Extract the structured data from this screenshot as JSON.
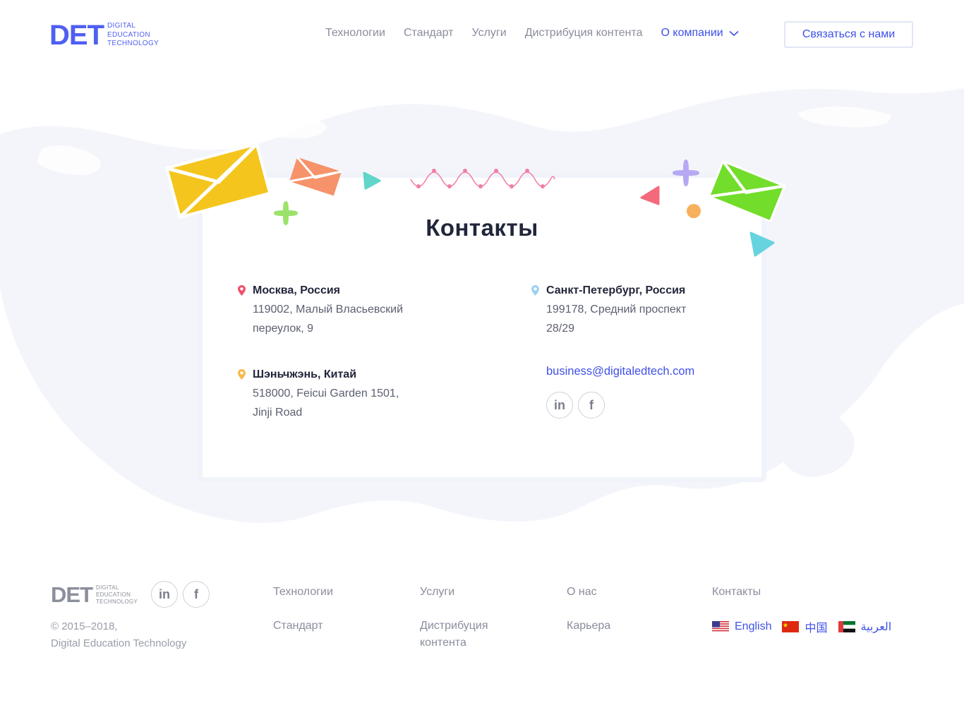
{
  "logo": {
    "mark": "DET",
    "line1": "DIGITAL",
    "line2": "EDUCATION",
    "line3": "TECHNOLOGY"
  },
  "nav": {
    "items": [
      "Технологии",
      "Стандарт",
      "Услуги",
      "Дистрибуция контента"
    ],
    "dropdown_label": "О компании",
    "contact_button": "Связаться с нами"
  },
  "contacts": {
    "title": "Контакты",
    "offices": [
      {
        "city": "Москва, Россия",
        "addr1": "119002, Малый Власьевский",
        "addr2": "переулок, 9",
        "pin_color": "#f0506e"
      },
      {
        "city": "Санкт-Петербург, Россия",
        "addr1": "199178, Средний проспект",
        "addr2": "28/29",
        "pin_color": "#9fd0f5"
      },
      {
        "city": "Шэньчжэнь, Китай",
        "addr1": "518000, Feicui Garden 1501,",
        "addr2": "Jinji Road",
        "pin_color": "#f7b84a"
      }
    ],
    "email": "business@digitaledtech.com",
    "socials": [
      "linkedin-icon",
      "facebook-icon"
    ],
    "social_glyphs": {
      "linkedin": "in",
      "facebook": "f"
    }
  },
  "footer": {
    "copyright_line1": "© 2015–2018,",
    "copyright_line2": "Digital Education Technology",
    "col1": [
      "Технологии",
      "Стандарт"
    ],
    "col2": [
      "Услуги",
      "Дистрибуция",
      "контента"
    ],
    "col3": [
      "О нас",
      "Карьера"
    ],
    "col4": [
      "Контакты"
    ],
    "languages": [
      {
        "label": "English",
        "flag": "us-flag-icon"
      },
      {
        "label": "中国",
        "flag": "china-flag-icon"
      },
      {
        "label": "العربية",
        "flag": "uae-flag-icon"
      }
    ]
  },
  "colors": {
    "accent": "#3f51e8",
    "brand": "#4f5ff2",
    "text": "#22263a",
    "muted": "#8a8d9c"
  }
}
